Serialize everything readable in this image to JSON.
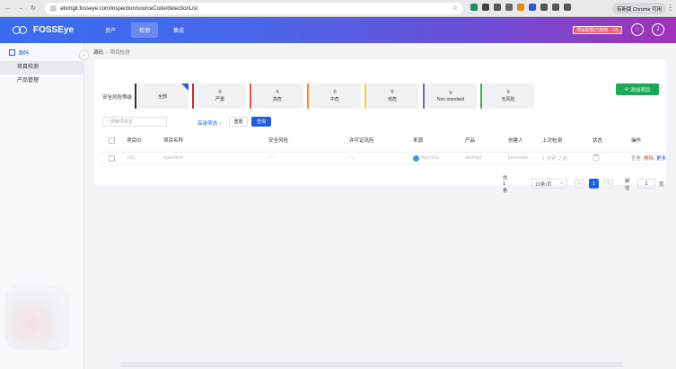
{
  "browser": {
    "url": "atomgit.fosseye.com/inspection/sourceCode/detectionList",
    "update_label": "有新版 Chrome 可用",
    "ext_colors": [
      "#1c8d5b",
      "#444444",
      "#555555",
      "#666666",
      "#e08a1e",
      "#2a5bd7",
      "#555555",
      "#555555",
      "#555555"
    ]
  },
  "header": {
    "logo_text": "FOSSEye",
    "menu": [
      {
        "label": "资产",
        "active": false
      },
      {
        "label": "检测",
        "active": true
      },
      {
        "label": "集成",
        "active": false
      }
    ],
    "quota_label": "项目配额已使用：1/5",
    "user_initial": "J"
  },
  "sidebar": {
    "section_label": "源码",
    "items": [
      {
        "label": "项目检测",
        "active": true
      },
      {
        "label": "产品管理",
        "active": false
      }
    ]
  },
  "breadcrumb": {
    "root": "源码",
    "current": "项目检测"
  },
  "risk_filter": {
    "label": "安全风险等级",
    "boxes": [
      {
        "count": "",
        "name": "全部",
        "color": "#333333",
        "selected": true
      },
      {
        "count": "0",
        "name": "严重",
        "color": "#b03a2e",
        "selected": false
      },
      {
        "count": "0",
        "name": "高危",
        "color": "#e0533c",
        "selected": false
      },
      {
        "count": "0",
        "name": "中危",
        "color": "#f0922e",
        "selected": false
      },
      {
        "count": "0",
        "name": "低危",
        "color": "#f3c73e",
        "selected": false
      },
      {
        "count": "0",
        "name": "Non-standard",
        "color": "#6b6bb4",
        "selected": false
      },
      {
        "count": "0",
        "name": "无风险",
        "color": "#4fae4f",
        "selected": false
      }
    ]
  },
  "add_project_label": "添加项目",
  "filters": {
    "search_placeholder": "搜索项目名",
    "advanced_label": "高级筛选",
    "reset_label": "重置",
    "query_label": "查询"
  },
  "table": {
    "columns": [
      "项目ID",
      "项目名称",
      "安全风险",
      "许可证风险",
      "来源",
      "产品",
      "创建人",
      "上次检测",
      "状态",
      "操作"
    ],
    "rows": [
      {
        "id": "102",
        "name": "openbmc",
        "security_risk": "—",
        "license_risk": "—",
        "source": "AtomGit",
        "product": "atomgit",
        "creator": "jasondan...",
        "last_check": "1 分钟 之前",
        "actions": {
          "detail": "查看",
          "delete": "删除",
          "more": "更多"
        }
      }
    ]
  },
  "pagination": {
    "total_label": "共 1 条",
    "page_size": "10条/页",
    "current_page": "1",
    "goto_label": "前往",
    "goto_value": "1",
    "page_suffix": "页"
  }
}
